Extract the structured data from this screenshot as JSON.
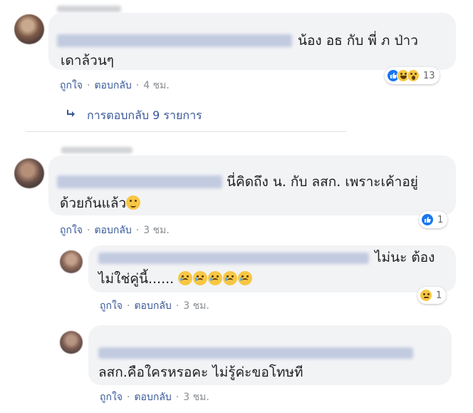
{
  "comments": [
    {
      "text_line1": "น้อง อธ กับ พี่ ภ ป่าว",
      "text_line2": "เดาล้วนๆ",
      "like": "ถูกใจ",
      "reply": "ตอบกลับ",
      "time": "4 ชม.",
      "reaction_count": "13",
      "replies_label": "การตอบกลับ 9 รายการ"
    },
    {
      "text_line1": "นี่คิดถึง น. กับ ลสก. เพราะเค้าอยู่",
      "text_line2": "ด้วยกันแล้ว",
      "like": "ถูกใจ",
      "reply": "ตอบกลับ",
      "time": "3 ชม.",
      "reaction_count": "1"
    },
    {
      "text_line1": "ไม่นะ ต้อง",
      "text_line2": "ไม่ใช่คู่นี้......",
      "like": "ถูกใจ",
      "reply": "ตอบกลับ",
      "time": "3 ชม.",
      "reaction_count": "1"
    },
    {
      "text_line1": "ลสก.คือใครหรอคะ ไม่รู้ค่ะขอโทษที",
      "like": "ถูกใจ",
      "reply": "ตอบกลับ",
      "time": "3 ชม."
    }
  ],
  "separator": "·",
  "colors": {
    "bubble": "#f2f3f5",
    "link": "#385898",
    "like_blue": "#1877f2",
    "emoji_yellow": "#f7c744"
  },
  "icons": [
    "reply-arrow-icon",
    "like-reaction-icon",
    "haha-reaction-icon",
    "wow-reaction-icon",
    "sad-reaction-icon",
    "tearful-face-emoji"
  ]
}
